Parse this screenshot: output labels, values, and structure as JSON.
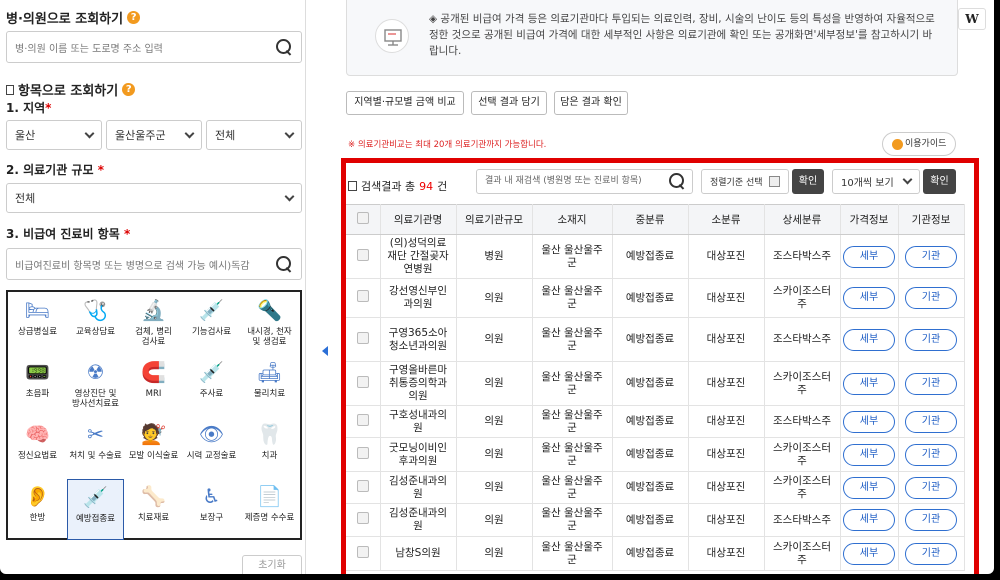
{
  "hospital_search": {
    "title": "병·의원으로 조회하기",
    "help": "?",
    "placeholder": "병·의원 이름 또는 도로명 주소 입력"
  },
  "item_search": {
    "title": "항목으로 조회하기",
    "help": "?"
  },
  "region": {
    "label": "1. 지역",
    "region1": "울산",
    "region2": "울산울주군",
    "region3": "전체"
  },
  "scale": {
    "label": "2. 의료기관 규모",
    "value": "전체"
  },
  "item": {
    "label": "3. 비급여 진료비 항목",
    "placeholder": "비급여진료비 항목명 또는 병명으로 검색 가능 예시)독감"
  },
  "categories": [
    {
      "l1": "상급병실료",
      "l2": ""
    },
    {
      "l1": "교육상담료",
      "l2": ""
    },
    {
      "l1": "검체, 병리",
      "l2": "검사료"
    },
    {
      "l1": "기능검사료",
      "l2": ""
    },
    {
      "l1": "내시경, 천자",
      "l2": "및 생검료"
    },
    {
      "l1": "초음파",
      "l2": ""
    },
    {
      "l1": "영상진단 및",
      "l2": "방사선치료료"
    },
    {
      "l1": "MRI",
      "l2": ""
    },
    {
      "l1": "주사료",
      "l2": ""
    },
    {
      "l1": "물리치료",
      "l2": ""
    },
    {
      "l1": "정신요법료",
      "l2": ""
    },
    {
      "l1": "처치 및 수술료",
      "l2": ""
    },
    {
      "l1": "모발 이식술료",
      "l2": ""
    },
    {
      "l1": "시력 교정술료",
      "l2": ""
    },
    {
      "l1": "치과",
      "l2": ""
    },
    {
      "l1": "한방",
      "l2": ""
    },
    {
      "l1": "예방접종료",
      "l2": ""
    },
    {
      "l1": "치료재료",
      "l2": ""
    },
    {
      "l1": "보장구",
      "l2": ""
    },
    {
      "l1": "제증명 수수료",
      "l2": ""
    }
  ],
  "reset_label": "초기화",
  "notice": "◈ 공개된 비급여 가격 등은 의료기관마다 투입되는 의료인력, 장비, 시술의 난이도 등의 특성을 반영하여 자율적으로 정한 것으로 공개된 비급여 가격에 대한 세부적인 사항은 의료기관에 확인 또는 공개화면'세부정보'를 참고하시기 바랍니다.",
  "tabs": {
    "compare": "지역별·규모별 금액 비교",
    "add": "선택 결과 담기",
    "confirm": "담은 결과 확인"
  },
  "warning": "※ 의료기관비교는 최대 20개 의료기관까지 가능합니다.",
  "guide": "이용가이드",
  "results": {
    "prefix": "검색결과 총",
    "count": "94",
    "suffix": "건",
    "search_placeholder": "결과 내 재검색 (병원명 또는 진료비 항목)",
    "sort": "정렬기준 선택",
    "ok": "확인",
    "per_page": "10개씩 보기"
  },
  "table": {
    "headers": [
      "",
      "의료기관명",
      "의료기관규모",
      "소재지",
      "중분류",
      "소분류",
      "상세분류",
      "가격정보",
      "기관정보"
    ],
    "rows": [
      {
        "name": "(의)성덕의료재단 간절곶자연병원",
        "scale": "병원",
        "addr": "울산 울산울주군",
        "mid": "예방접종료",
        "small": "대상포진",
        "detail": "조스타박스주",
        "price": "세부",
        "inst": "기관"
      },
      {
        "name": "강선영신부인과의원",
        "scale": "의원",
        "addr": "울산 울산울주군",
        "mid": "예방접종료",
        "small": "대상포진",
        "detail": "스카이조스터주",
        "price": "세부",
        "inst": "기관"
      },
      {
        "name": "구영365소아청소년과의원",
        "scale": "의원",
        "addr": "울산 울산울주군",
        "mid": "예방접종료",
        "small": "대상포진",
        "detail": "조스타박스주",
        "price": "세부",
        "inst": "기관"
      },
      {
        "name": "구영올바른마취통증의학과의원",
        "scale": "의원",
        "addr": "울산 울산울주군",
        "mid": "예방접종료",
        "small": "대상포진",
        "detail": "스카이조스터주",
        "price": "세부",
        "inst": "기관"
      },
      {
        "name": "구호성내과의원",
        "scale": "의원",
        "addr": "울산 울산울주군",
        "mid": "예방접종료",
        "small": "대상포진",
        "detail": "조스타박스주",
        "price": "세부",
        "inst": "기관"
      },
      {
        "name": "굿모닝이비인후과의원",
        "scale": "의원",
        "addr": "울산 울산울주군",
        "mid": "예방접종료",
        "small": "대상포진",
        "detail": "스카이조스터주",
        "price": "세부",
        "inst": "기관"
      },
      {
        "name": "김성준내과의원",
        "scale": "의원",
        "addr": "울산 울산울주군",
        "mid": "예방접종료",
        "small": "대상포진",
        "detail": "스카이조스터주",
        "price": "세부",
        "inst": "기관"
      },
      {
        "name": "김성준내과의원",
        "scale": "의원",
        "addr": "울산 울산울주군",
        "mid": "예방접종료",
        "small": "대상포진",
        "detail": "조스타박스주",
        "price": "세부",
        "inst": "기관"
      },
      {
        "name": "남창S의원",
        "scale": "의원",
        "addr": "울산 울산울주군",
        "mid": "예방접종료",
        "small": "대상포진",
        "detail": "스카이조스터주",
        "price": "세부",
        "inst": "기관"
      }
    ]
  }
}
